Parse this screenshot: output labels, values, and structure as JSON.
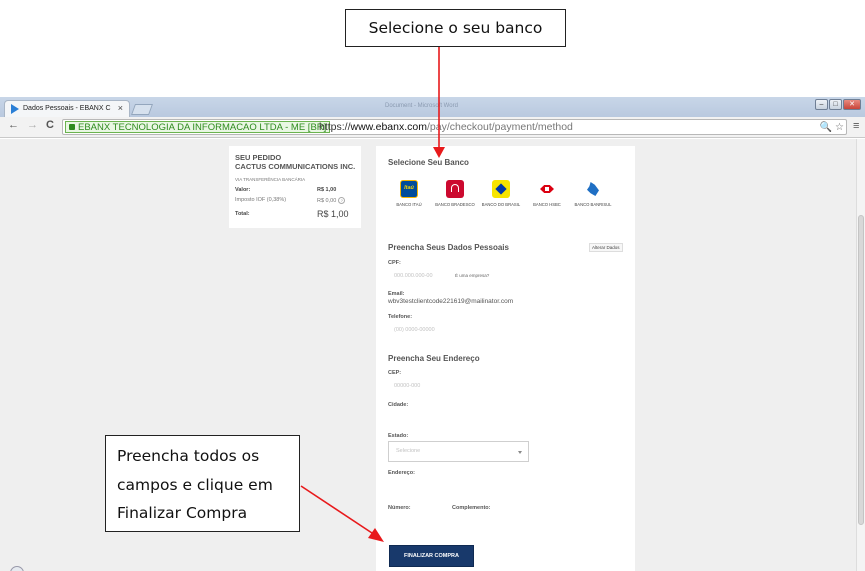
{
  "browser": {
    "tab_title": "Dados Pessoais - EBANX C",
    "tab_close": "×",
    "ghost_tab_1": "Document - Microsoft Word",
    "ev_label": "EBANX TECNOLOGIA DA INFORMACAO LTDA - ME [BR]",
    "url_scheme": "https://",
    "url_domain": "www.ebanx.com",
    "url_path": "/pay/checkout/payment/method",
    "back": "←",
    "forward": "→",
    "reload": "C",
    "zoom": "🔍",
    "star": "☆",
    "menu": "≡",
    "win_min": "–",
    "win_max": "□",
    "win_close": "✕"
  },
  "order": {
    "heading": "SEU PEDIDO",
    "merchant": "CACTUS COMMUNICATIONS INC.",
    "via": "VIA TRANSFERÊNCIA BANCÁRIA",
    "valor_label": "Valor:",
    "valor": "R$ 1,00",
    "iof_label": "Imposto IOF (0,38%)",
    "iof": "R$ 0,00",
    "help": "?",
    "total_label": "Total:",
    "total": "R$ 1,00"
  },
  "form": {
    "bank_section_title": "Selecione Seu Banco",
    "banks": [
      {
        "name": "BANCO ITAÚ",
        "logo_text": "Itaú"
      },
      {
        "name": "BANCO BRADESCO"
      },
      {
        "name": "BANCO DO BRASIL"
      },
      {
        "name": "BANCO HSBC"
      },
      {
        "name": "BANCO BANRISUL"
      }
    ],
    "personal_title": "Preencha Seus Dados Pessoais",
    "alterar": "Alterar Dados",
    "cpf_label": "CPF:",
    "cpf_placeholder": "000.000.000-00",
    "empresa": "É uma empresa?",
    "email_label": "Email:",
    "email_value": "wbv3testclientcode221619@mailinator.com",
    "telefone_label": "Telefone:",
    "telefone_placeholder": "(00) 0000-00000",
    "address_title": "Preencha Seu Endereço",
    "cep_label": "CEP:",
    "cep_placeholder": "00000-000",
    "cidade_label": "Cidade:",
    "estado_label": "Estado:",
    "estado_placeholder": "Selecione",
    "endereco_label": "Endereço:",
    "numero_label": "Número:",
    "complemento_label": "Complemento:",
    "submit_label": "FINALIZAR COMPRA"
  },
  "annotations": {
    "top": "Selecione o seu banco",
    "bottom_line1": "Preencha todos os",
    "bottom_line2": "campos e clique em",
    "bottom_line3": "Finalizar Compra",
    "arrow_color": "#e8191b"
  }
}
